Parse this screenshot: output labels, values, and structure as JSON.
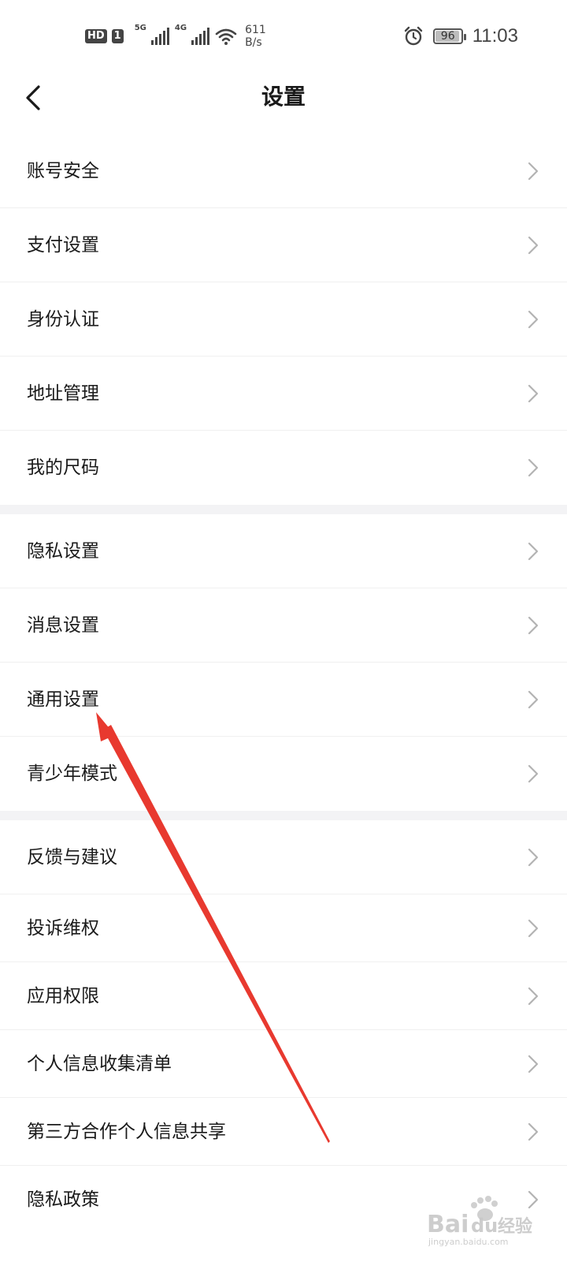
{
  "status_bar": {
    "hd_label": "HD",
    "sim_label": "1",
    "net_5g": "5G",
    "net_4g": "4G",
    "speed_value": "611",
    "speed_unit": "B/s",
    "battery_level": "96",
    "battery_fraction": 0.96,
    "time": "11:03",
    "icons": [
      "signal-icon",
      "wifi-icon",
      "alarm-icon",
      "battery-icon"
    ]
  },
  "header": {
    "title": "设置",
    "back_icon": "back-arrow-icon"
  },
  "settings": {
    "groups": [
      {
        "items": [
          {
            "label": "账号安全"
          },
          {
            "label": "支付设置"
          },
          {
            "label": "身份认证"
          },
          {
            "label": "地址管理"
          },
          {
            "label": "我的尺码"
          }
        ]
      },
      {
        "items": [
          {
            "label": "隐私设置"
          },
          {
            "label": "消息设置"
          },
          {
            "label": "通用设置"
          },
          {
            "label": "青少年模式"
          }
        ]
      },
      {
        "items": [
          {
            "label": "反馈与建议"
          },
          {
            "label": "投诉维权"
          },
          {
            "label": "应用权限"
          },
          {
            "label": "个人信息收集清单"
          },
          {
            "label": "第三方合作个人信息共享"
          },
          {
            "label": "隐私政策"
          }
        ]
      }
    ]
  },
  "annotation": {
    "arrow_color": "#e8392f",
    "target": "通用设置"
  },
  "watermark": {
    "brand": "Bai",
    "brand_du": "du",
    "product": "经验",
    "url": "jingyan.baidu.com"
  },
  "colors": {
    "background": "#ffffff",
    "group_gap": "#f3f3f5",
    "text": "#1a1a1a",
    "chevron": "#b3b3b3",
    "divider": "#f0f0f0"
  }
}
